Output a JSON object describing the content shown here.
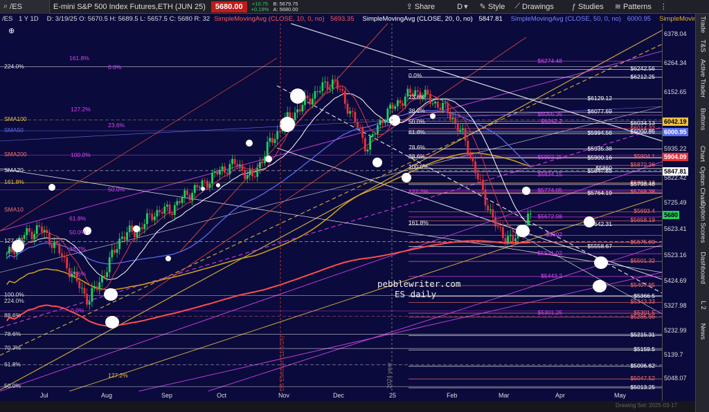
{
  "toolbar": {
    "symbol": "/ES",
    "timeframe": "1 Y 1D",
    "description": "E-mini S&P 500 Index Futures,ETH (JUN 25)",
    "price": "5680.00",
    "change": "+10.75",
    "change_pct": "+0.19%",
    "bid": "B: 5679.75",
    "ask": "A: 5680.00",
    "share": "Share",
    "style": "Style",
    "drawings": "Drawings",
    "studies": "Studies",
    "patterns": "Patterns"
  },
  "legend": {
    "ohlc": "D: 3/19/25   O: 5670.5   H: 5689.5   L: 5657.5   C: 5680   R: 32",
    "sma10": "SimpleMovingAvg (CLOSE, 10, 0, no)",
    "sma10_val": "5693.35",
    "sma20": "SimpleMovingAvg (CLOSE, 20, 0, no)",
    "sma20_val": "5847.81",
    "sma50": "SimpleMovingAvg (CLOSE, 50, 0, no)",
    "sma50_val": "6000.95",
    "sma200": "SimpleMovingAvg (C"
  },
  "sidebar": [
    "Trade",
    "T&S",
    "Active Trader",
    "Buttons",
    "Chart",
    "Option Chain",
    "Option Scores",
    "Dashboard",
    "L 2",
    "News"
  ],
  "price_axis": [
    "6378.04",
    "6264.34",
    "6152.65",
    "6042.19",
    "6000.95",
    "5935.22",
    "5904.09",
    "5847.81",
    "5822.42",
    "5725.49",
    "5680",
    "5623.41",
    "5523.16",
    "5424.69",
    "5327.98",
    "5232.99",
    "5139.7",
    "5048.07"
  ],
  "time_axis": [
    "Jul",
    "Aug",
    "Sep",
    "Oct",
    "Nov",
    "Dec",
    "25",
    "Feb",
    "Mar",
    "Apr",
    "May"
  ],
  "watermark": {
    "line1": "pebblewriter.com",
    "line2": "ES daily"
  },
  "vertical_labels": {
    "election": "US Election (11/5/24)",
    "year": "2024 year"
  },
  "footer": "Drawing Set: 2025-03-17",
  "chart_data": {
    "type": "candlestick",
    "ylim": [
      5000,
      6420
    ],
    "x": [
      "Jul",
      "Aug",
      "Sep",
      "Oct",
      "Nov",
      "Dec",
      "25",
      "Feb",
      "Mar",
      "Apr",
      "May"
    ],
    "close_path": [
      5520,
      5600,
      5630,
      5560,
      5450,
      5350,
      5460,
      5600,
      5620,
      5690,
      5700,
      5760,
      5800,
      5850,
      5880,
      5820,
      5950,
      6040,
      6100,
      6160,
      6200,
      6080,
      5940,
      6060,
      6120,
      6160,
      6120,
      6080,
      5970,
      5780,
      5620,
      5580,
      5680
    ],
    "moving_averages": [
      {
        "name": "SMA10",
        "value": "5693.35",
        "color": "#e0364b"
      },
      {
        "name": "SMA20",
        "value": "5847.81",
        "color": "#ffffff"
      },
      {
        "name": "SMA50",
        "value": "6000.95",
        "color": "#5a6cf0"
      },
      {
        "name": "SMA200",
        "value": "5904.09",
        "color": "#d4a419"
      }
    ],
    "levels": [
      {
        "value": "6274.48",
        "color": "#d946ef"
      },
      {
        "value": "6242.56",
        "color": "#ffffff"
      },
      {
        "value": "6212.25",
        "color": "#ffffff"
      },
      {
        "value": "6129.12",
        "color": "#ffffff"
      },
      {
        "value": "6077.69",
        "color": "#ffffff"
      },
      {
        "value": "6066.36",
        "color": "#d946ef"
      },
      {
        "value": "6042.2",
        "color": "#d946ef"
      },
      {
        "value": "6034.13",
        "color": "#ffffff"
      },
      {
        "value": "6014.32",
        "color": "#ff7070"
      },
      {
        "value": "6000.86",
        "color": "#ffffff"
      },
      {
        "value": "5994.56",
        "color": "#ffffff"
      },
      {
        "value": "5935.38",
        "color": "#ffffff"
      },
      {
        "value": "5904.1",
        "color": "#ff7070"
      },
      {
        "value": "5902.75",
        "color": "#d946ef"
      },
      {
        "value": "5900.16",
        "color": "#ffffff"
      },
      {
        "value": "5872.36",
        "color": "#ff7070"
      },
      {
        "value": "5860",
        "color": "#ffffff"
      },
      {
        "value": "5847.85",
        "color": "#ffffff"
      },
      {
        "value": "5834.15",
        "color": "#d946ef"
      },
      {
        "value": "5803.13",
        "color": "#ff7070"
      },
      {
        "value": "5798.48",
        "color": "#ffffff"
      },
      {
        "value": "5774.05",
        "color": "#d946ef"
      },
      {
        "value": "5768.38",
        "color": "#ff7070"
      },
      {
        "value": "5764.19",
        "color": "#ffffff"
      },
      {
        "value": "5693.4",
        "color": "#ff7070"
      },
      {
        "value": "5672.98",
        "color": "#d946ef"
      },
      {
        "value": "5658.19",
        "color": "#ff7070"
      },
      {
        "value": "5642.31",
        "color": "#ffffff"
      },
      {
        "value": "5602",
        "color": "#d946ef"
      },
      {
        "value": "5575.09",
        "color": "#ff7070"
      },
      {
        "value": "5558.67",
        "color": "#ffffff"
      },
      {
        "value": "5531.02",
        "color": "#d946ef"
      },
      {
        "value": "5501.32",
        "color": "#ff7070"
      },
      {
        "value": "5443.2",
        "color": "#d946ef"
      },
      {
        "value": "5407.95",
        "color": "#ff7070"
      },
      {
        "value": "5366.5",
        "color": "#ffffff"
      },
      {
        "value": "5343.33",
        "color": "#ff7070"
      },
      {
        "value": "5301.5",
        "color": "#ff7070"
      },
      {
        "value": "5301.25",
        "color": "#d946ef"
      },
      {
        "value": "5285.96",
        "color": "#ff7070"
      },
      {
        "value": "5215.31",
        "color": "#ffffff"
      },
      {
        "value": "5159.5",
        "color": "#ffffff"
      },
      {
        "value": "5096.62",
        "color": "#ffffff"
      },
      {
        "value": "5047.52",
        "color": "#ff7070"
      },
      {
        "value": "5013.25",
        "color": "#ffffff"
      }
    ],
    "left_labels": [
      {
        "text": "224.0%",
        "y": 6253,
        "color": "#ddd"
      },
      {
        "text": "161.8%",
        "y": 6285,
        "color": "#d946ef"
      },
      {
        "text": "0.0%",
        "y": 6250,
        "color": "#d946ef"
      },
      {
        "text": "127.2%",
        "y": 6086,
        "color": "#d946ef"
      },
      {
        "text": "SMA100",
        "y": 6048,
        "color": "#f0c040"
      },
      {
        "text": "23.6%",
        "y": 6024,
        "color": "#d946ef"
      },
      {
        "text": "SMA50",
        "y": 6006,
        "color": "#5a6cf0"
      },
      {
        "text": "100.0%",
        "y": 5910,
        "color": "#d946ef"
      },
      {
        "text": "SMA200",
        "y": 5912,
        "color": "#ff7070"
      },
      {
        "text": "SMA20",
        "y": 5852,
        "color": "#eee"
      },
      {
        "text": "161.8%",
        "y": 5805,
        "color": "#f0c040"
      },
      {
        "text": "50.0%",
        "y": 5778,
        "color": "#d946ef"
      },
      {
        "text": "SMA10",
        "y": 5698,
        "color": "#ff7070"
      },
      {
        "text": "61.8%",
        "y": 5665,
        "color": "#d946ef"
      },
      {
        "text": "50.0%",
        "y": 5612,
        "color": "#d946ef"
      },
      {
        "text": "127.2%",
        "y": 5578,
        "color": "#ddd"
      },
      {
        "text": "38.2%",
        "y": 5548,
        "color": "#d946ef"
      },
      {
        "text": "23.6%",
        "y": 5452,
        "color": "#d946ef"
      },
      {
        "text": "100.0%",
        "y": 5370,
        "color": "#ddd"
      },
      {
        "text": "224.0%",
        "y": 5348,
        "color": "#ddd"
      },
      {
        "text": "0.0%",
        "y": 5310,
        "color": "#d946ef"
      },
      {
        "text": "88.6%",
        "y": 5290,
        "color": "#ddd"
      },
      {
        "text": "78.6%",
        "y": 5220,
        "color": "#ddd"
      },
      {
        "text": "70.7%",
        "y": 5165,
        "color": "#ddd"
      },
      {
        "text": "61.8%",
        "y": 5102,
        "color": "#ddd"
      },
      {
        "text": "50.0%",
        "y": 5018,
        "color": "#ddd"
      },
      {
        "text": "127.2%",
        "y": 5060,
        "color": "#f0c040"
      }
    ],
    "mid_labels": [
      {
        "text": "0.0%",
        "y": 6217,
        "color": "#eee"
      },
      {
        "text": "23.6%",
        "y": 6135,
        "color": "#eee"
      },
      {
        "text": "38.2%",
        "y": 6082,
        "color": "#eee"
      },
      {
        "text": "50.0%",
        "y": 6039,
        "color": "#eee"
      },
      {
        "text": "61.8%",
        "y": 5998,
        "color": "#eee"
      },
      {
        "text": "78.6%",
        "y": 5940,
        "color": "#eee"
      },
      {
        "text": "88.6%",
        "y": 5905,
        "color": "#eee"
      },
      {
        "text": "100.0%",
        "y": 5865,
        "color": "#eee"
      },
      {
        "text": "127.2%",
        "y": 5770,
        "color": "#d946ef"
      },
      {
        "text": "161.8%",
        "y": 5648,
        "color": "#eee"
      }
    ]
  }
}
